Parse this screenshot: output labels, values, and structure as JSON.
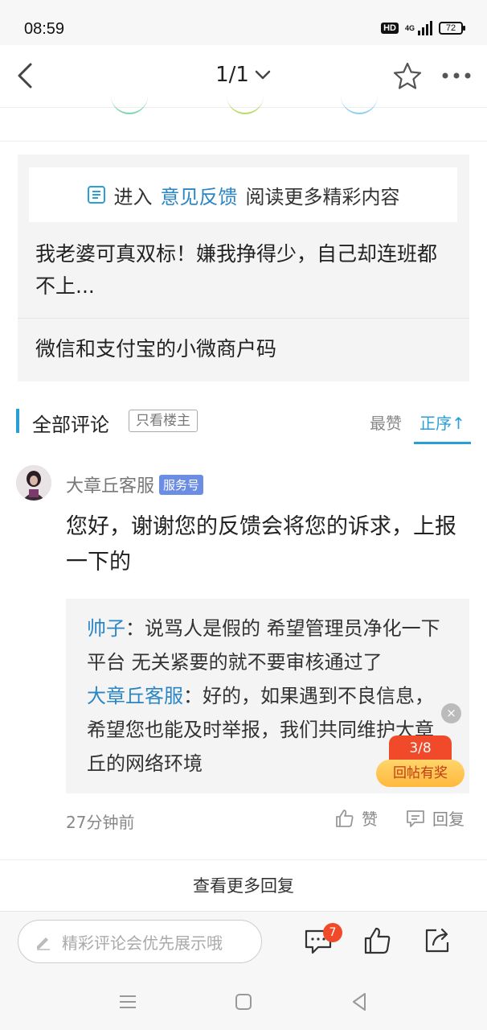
{
  "status_bar": {
    "time": "08:59",
    "hd": "HD",
    "network": "4G",
    "battery": "72"
  },
  "nav": {
    "page_indicator": "1/1"
  },
  "related": {
    "banner_prefix": "进入",
    "banner_link": "意见反馈",
    "banner_suffix": "阅读更多精彩内容",
    "items": [
      "我老婆可真双标！嫌我挣得少，自己却连班都不上...",
      "微信和支付宝的小微商户码"
    ]
  },
  "comments": {
    "title": "全部评论",
    "owner_only_label": "只看楼主",
    "sort_hot_label": "最赞",
    "sort_order_label": "正序↑",
    "items": [
      {
        "username": "大章丘客服",
        "badge": "服务号",
        "text": "您好，谢谢您的反馈会将您的诉求，上报一下的",
        "quotes": [
          {
            "user": "帅子",
            "text": "：说骂人是假的 希望管理员净化一下平台 无关紧要的就不要审核通过了"
          },
          {
            "user": "大章丘客服",
            "text": "：好的，如果遇到不良信息，希望您也能及时举报，我们共同维护大章丘的网络环境"
          }
        ],
        "time": "27分钟前",
        "like_label": "赞",
        "reply_label": "回复"
      }
    ],
    "more_replies_label": "查看更多回复"
  },
  "float_reward": {
    "progress": "3/8",
    "label": "回帖有奖",
    "close": "×"
  },
  "toolbar": {
    "comment_placeholder": "精彩评论会优先展示哦",
    "comment_count_badge": "7"
  },
  "colors": {
    "accent": "#2a9fd6",
    "link": "#2a86c5",
    "badge_red": "#f04a2a",
    "service_badge": "#6b8de3"
  }
}
